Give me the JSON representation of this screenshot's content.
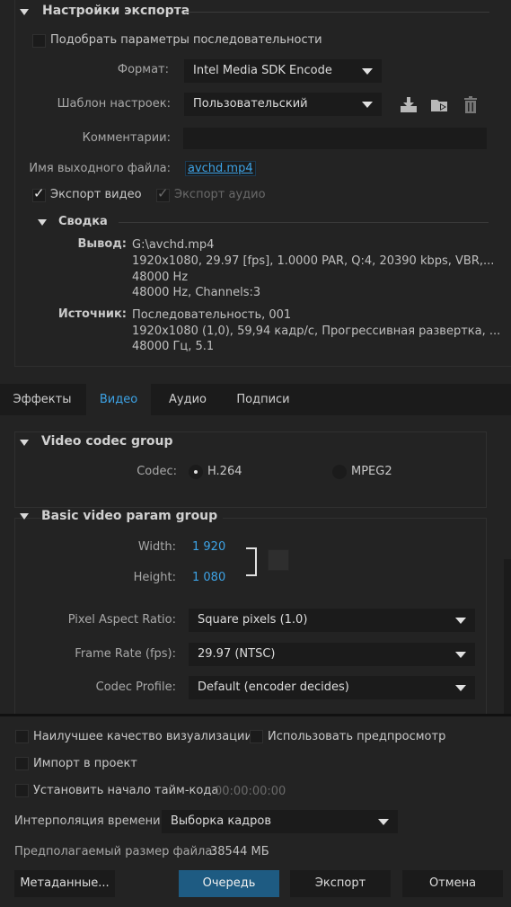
{
  "export_settings": {
    "title": "Настройки экспорта",
    "match_sequence": "Подобрать параметры последовательности",
    "format_label": "Формат:",
    "format_value": "Intel Media SDK Encode",
    "preset_label": "Шаблон настроек:",
    "preset_value": "Пользовательский",
    "comments_label": "Комментарии:",
    "comments_value": "",
    "output_name_label": "Имя выходного файла:",
    "output_name_value": "avchd.mp4",
    "export_video": "Экспорт видео",
    "export_audio": "Экспорт аудио",
    "export_video_checked": true,
    "export_audio_checked": true
  },
  "summary": {
    "title": "Сводка",
    "output_label": "Вывод:",
    "output_lines": [
      "G:\\avchd.mp4",
      "1920x1080, 29.97 [fps], 1.0000 PAR, Q:4, 20390 kbps, VBR,...",
      "48000 Hz",
      "48000 Hz, Channels:3"
    ],
    "source_label": "Источник:",
    "source_lines": [
      "Последовательность, 001",
      "1920x1080 (1,0), 59,94 кадр/с, Прогрессивная развертка, ...",
      "48000 Гц, 5.1"
    ]
  },
  "tabs": [
    "Эффекты",
    "Видео",
    "Аудио",
    "Подписи"
  ],
  "active_tab": "Видео",
  "codec_group": {
    "title": "Video codec group",
    "codec_label": "Codec:",
    "options": [
      "H.264",
      "MPEG2"
    ],
    "selected": "H.264"
  },
  "basic_group": {
    "title": "Basic video param group",
    "width_label": "Width:",
    "width_value": "1 920",
    "height_label": "Height:",
    "height_value": "1 080",
    "par_label": "Pixel Aspect Ratio:",
    "par_value": "Square pixels (1.0)",
    "fps_label": "Frame Rate (fps):",
    "fps_value": "29.97 (NTSC)",
    "profile_label": "Codec Profile:",
    "profile_value": "Default (encoder decides)"
  },
  "bottom": {
    "max_quality": "Наилучшее качество визуализации",
    "use_previews": "Использовать предпросмотр",
    "import_project": "Импорт в проект",
    "set_timecode": "Установить начало тайм-кода",
    "timecode_value": "00:00:00:00",
    "interp_label": "Интерполяция времени:",
    "interp_value": "Выборка кадров",
    "file_size_label": "Предполагаемый размер файла:",
    "file_size_value": "38544 МБ"
  },
  "buttons": {
    "metadata": "Метаданные...",
    "queue": "Очередь",
    "export": "Экспорт",
    "cancel": "Отмена"
  },
  "colors": {
    "accent": "#3da3e6",
    "queue_button": "#1e5b82",
    "background": "#232323"
  }
}
